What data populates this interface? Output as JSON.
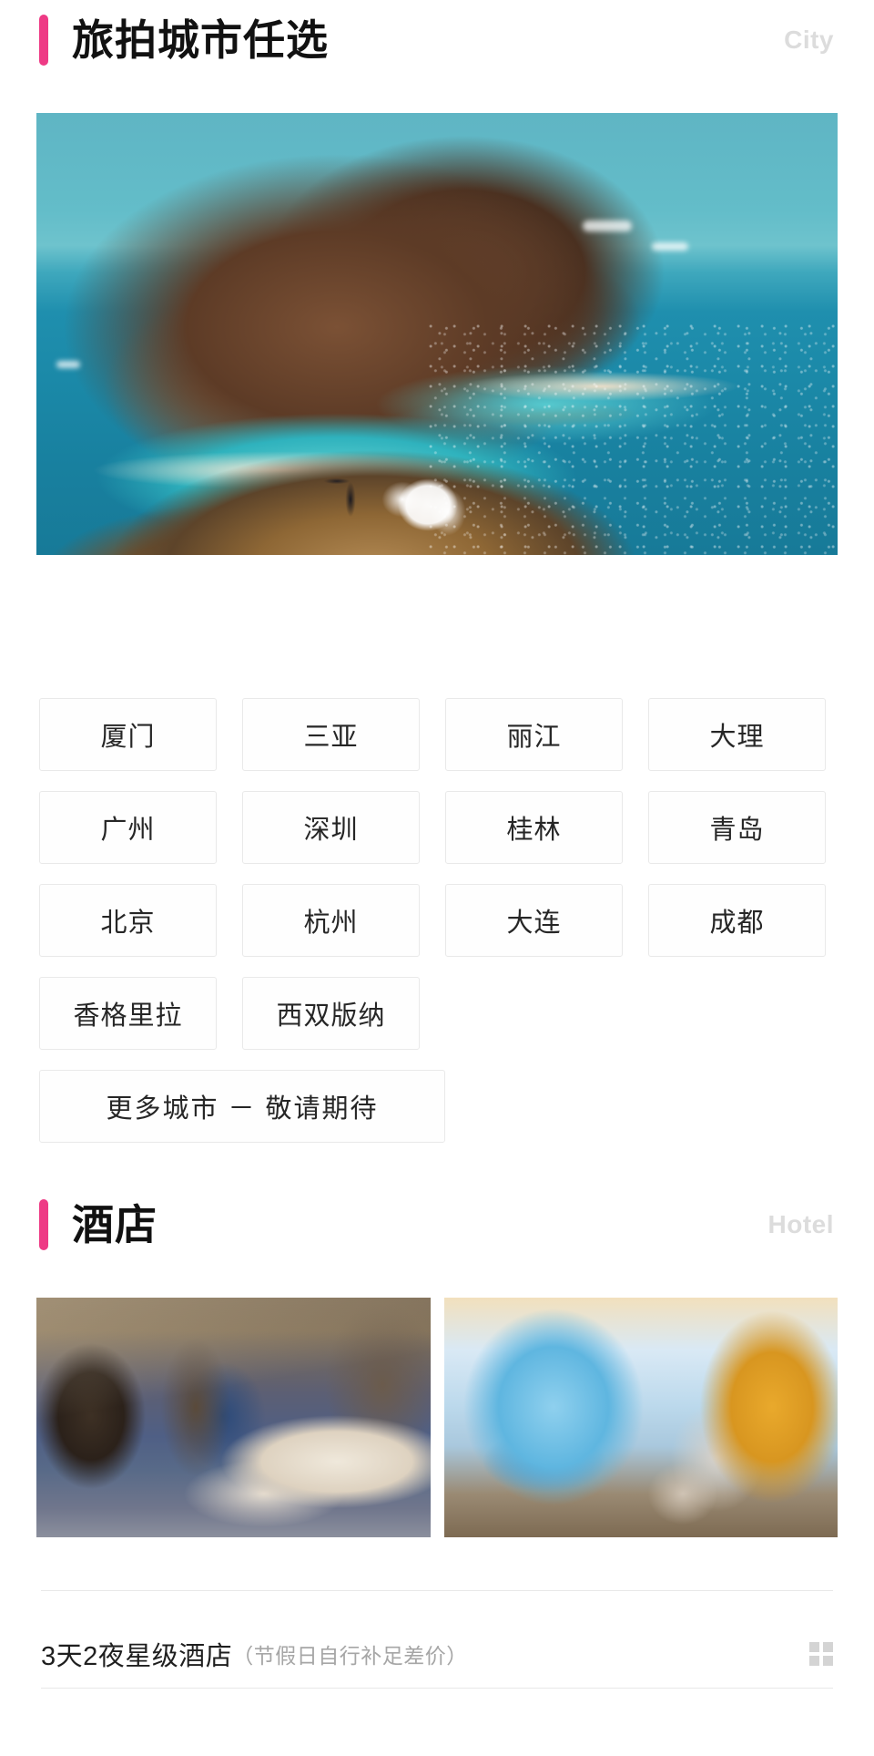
{
  "theme": {
    "accent_color": "#ee3a85",
    "subtitle_color": "#dcdcdc",
    "border_color": "#e9e9e9",
    "divider_color": "#e8e8e8",
    "icon_color": "#d4d4d4"
  },
  "city_section": {
    "title": "旅拍城市任选",
    "subtitle": "City",
    "hero_alt": "海岛山崖婚纱旅拍",
    "cities": [
      {
        "label": "厦门",
        "wide": false
      },
      {
        "label": "三亚",
        "wide": false
      },
      {
        "label": "丽江",
        "wide": false
      },
      {
        "label": "大理",
        "wide": false
      },
      {
        "label": "广州",
        "wide": false
      },
      {
        "label": "深圳",
        "wide": false
      },
      {
        "label": "桂林",
        "wide": false
      },
      {
        "label": "青岛",
        "wide": false
      },
      {
        "label": "北京",
        "wide": false
      },
      {
        "label": "杭州",
        "wide": false
      },
      {
        "label": "大连",
        "wide": false
      },
      {
        "label": "成都",
        "wide": false
      },
      {
        "label": "香格里拉",
        "wide": false
      },
      {
        "label": "西双版纳",
        "wide": false
      },
      {
        "label": "更多城市 － 敬请期待",
        "wide": true
      }
    ]
  },
  "hotel_section": {
    "title": "酒店",
    "subtitle": "Hotel",
    "photos": [
      {
        "alt": "星级酒店客房海景大床房"
      },
      {
        "alt": "星级酒店落地窗海景休息区"
      }
    ],
    "caption": {
      "main": "3天2夜星级酒店",
      "note": "（节假日自行补足差价）",
      "grid_icon": "grid-2x2-icon"
    }
  }
}
